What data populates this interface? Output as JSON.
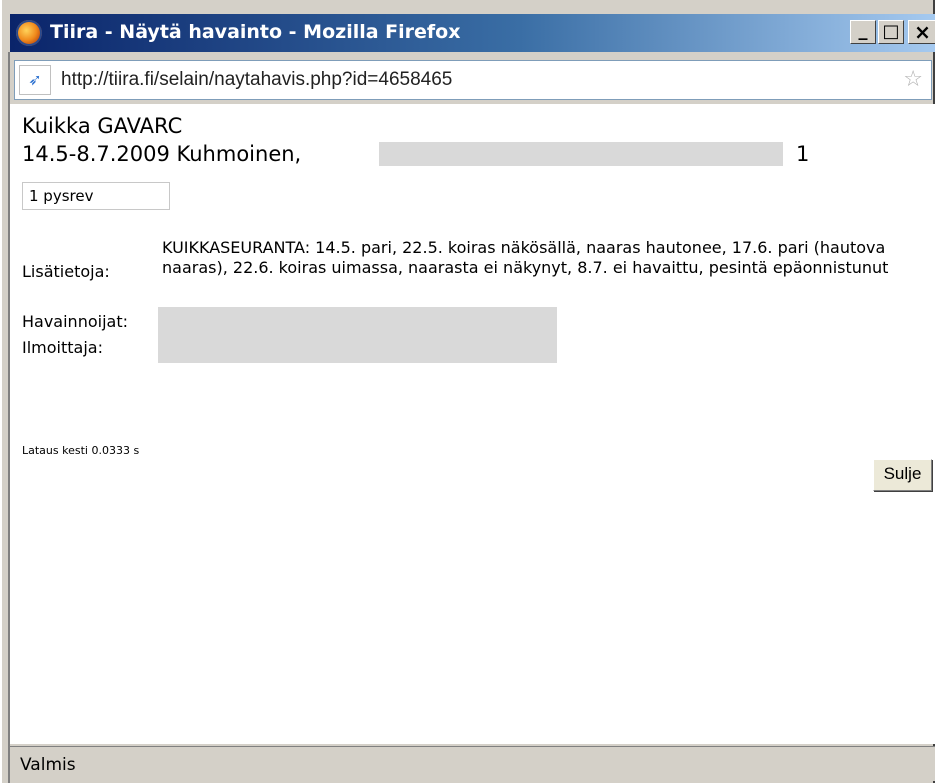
{
  "window": {
    "title": "Tiira - Näytä havainto - Mozilla Firefox",
    "buttons": {
      "minimize": "_",
      "maximize": "□",
      "close": "×"
    }
  },
  "address_bar": {
    "url": "http://tiira.fi/selain/naytahavis.php?id=4658465"
  },
  "observation": {
    "species": "Kuikka GAVARC",
    "date_place": "14.5-8.7.2009 Kuhmoinen,",
    "count": "1",
    "age_status": "1  pysrev",
    "info_label": "Lisätietoja:",
    "info_text": "KUIKKASEURANTA: 14.5. pari, 22.5. koiras näkösällä, naaras hautonee, 17.6. pari (hautova naaras), 22.6. koiras uimassa, naarasta ei näkynyt, 8.7. ei havaittu, pesintä epäonnistunut",
    "observers_label": "Havainnoijat:",
    "reporter_label": "Ilmoittaja:"
  },
  "footer": {
    "load_time": "Lataus kesti 0.0333 s",
    "close_button": "Sulje"
  },
  "status_bar": {
    "text": "Valmis"
  },
  "icons": [
    "firefox-icon",
    "site-favicon-icon",
    "bookmark-star-icon"
  ]
}
